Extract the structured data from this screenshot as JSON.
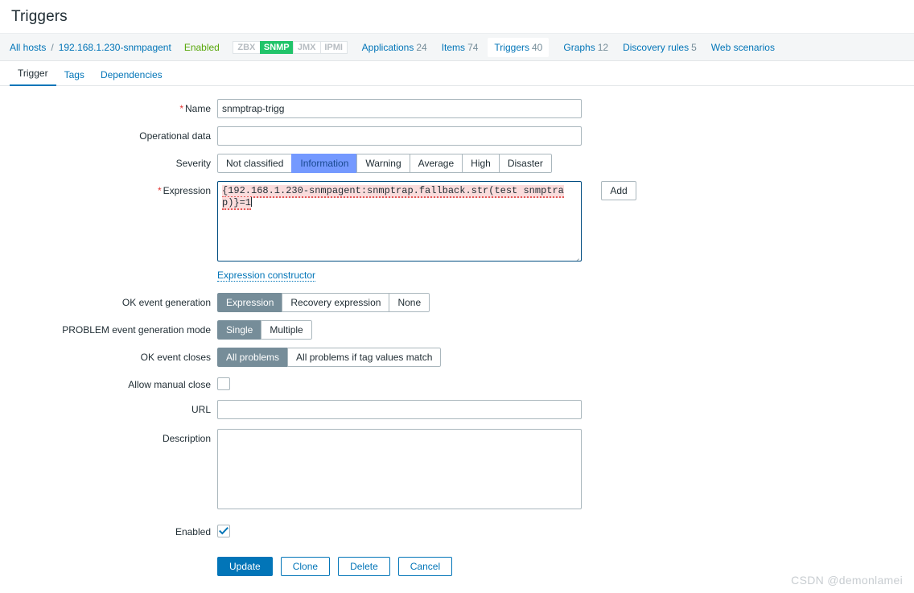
{
  "page": {
    "title": "Triggers"
  },
  "hostnav": {
    "all_hosts": "All hosts",
    "separator": "/",
    "host": "192.168.1.230-snmpagent",
    "status": "Enabled",
    "availability": [
      {
        "label": "ZBX",
        "active": false
      },
      {
        "label": "SNMP",
        "active": true
      },
      {
        "label": "JMX",
        "active": false
      },
      {
        "label": "IPMI",
        "active": false
      }
    ],
    "links": [
      {
        "label": "Applications",
        "count": "24",
        "selected": false
      },
      {
        "label": "Items",
        "count": "74",
        "selected": false
      },
      {
        "label": "Triggers",
        "count": "40",
        "selected": true
      },
      {
        "label": "Graphs",
        "count": "12",
        "selected": false
      },
      {
        "label": "Discovery rules",
        "count": "5",
        "selected": false
      },
      {
        "label": "Web scenarios",
        "count": "",
        "selected": false
      }
    ]
  },
  "tabs": [
    {
      "label": "Trigger",
      "active": true
    },
    {
      "label": "Tags",
      "active": false
    },
    {
      "label": "Dependencies",
      "active": false
    }
  ],
  "form": {
    "name": {
      "label": "Name",
      "required": true,
      "value": "snmptrap-trigg",
      "placeholder": ""
    },
    "operational_data": {
      "label": "Operational data",
      "value": "",
      "placeholder": ""
    },
    "severity": {
      "label": "Severity",
      "options": [
        {
          "label": "Not classified",
          "selected": false
        },
        {
          "label": "Information",
          "selected": true
        },
        {
          "label": "Warning",
          "selected": false
        },
        {
          "label": "Average",
          "selected": false
        },
        {
          "label": "High",
          "selected": false
        },
        {
          "label": "Disaster",
          "selected": false
        }
      ]
    },
    "expression": {
      "label": "Expression",
      "required": true,
      "value": "{192.168.1.230-snmpagent:snmptrap.fallback.str(test snmptrap)}=1",
      "add_button": "Add",
      "constructor_link": "Expression constructor"
    },
    "ok_event_generation": {
      "label": "OK event generation",
      "options": [
        {
          "label": "Expression",
          "selected": true
        },
        {
          "label": "Recovery expression",
          "selected": false
        },
        {
          "label": "None",
          "selected": false
        }
      ]
    },
    "problem_event_generation_mode": {
      "label": "PROBLEM event generation mode",
      "options": [
        {
          "label": "Single",
          "selected": true
        },
        {
          "label": "Multiple",
          "selected": false
        }
      ]
    },
    "ok_event_closes": {
      "label": "OK event closes",
      "options": [
        {
          "label": "All problems",
          "selected": true
        },
        {
          "label": "All problems if tag values match",
          "selected": false
        }
      ]
    },
    "allow_manual_close": {
      "label": "Allow manual close",
      "checked": false
    },
    "url": {
      "label": "URL",
      "value": "",
      "placeholder": ""
    },
    "description": {
      "label": "Description",
      "value": "",
      "placeholder": ""
    },
    "enabled": {
      "label": "Enabled",
      "checked": true
    }
  },
  "actions": {
    "update": "Update",
    "clone": "Clone",
    "delete": "Delete",
    "cancel": "Cancel"
  },
  "watermark": "CSDN @demonlamei",
  "colors": {
    "accent": "#0275b8",
    "enabled_green": "#59a80c",
    "snmp_green": "#21c46a",
    "selected_grey": "#768d99",
    "severity_information": "#7499ff",
    "expression_highlight": "#fadcdc",
    "required_red": "#e33734"
  }
}
